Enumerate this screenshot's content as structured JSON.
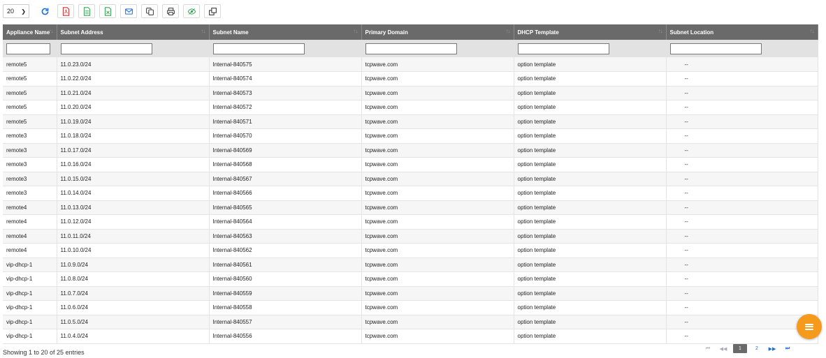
{
  "toolbar": {
    "page_size": "20",
    "buttons": [
      {
        "name": "refresh-icon",
        "color": "#1e6fd9"
      },
      {
        "name": "pdf-icon",
        "color": "#d9322b"
      },
      {
        "name": "csv-icon",
        "color": "#3aa655"
      },
      {
        "name": "excel-icon",
        "color": "#3aa655"
      },
      {
        "name": "email-icon",
        "color": "#1e6fd9"
      },
      {
        "name": "copy-icon",
        "color": "#333333"
      },
      {
        "name": "print-icon",
        "color": "#333333"
      },
      {
        "name": "visibility-icon",
        "color": "#3aa655"
      },
      {
        "name": "columns-icon",
        "color": "#333333"
      }
    ]
  },
  "table": {
    "columns": [
      "Appliance Name",
      "Subnet Address",
      "Subnet Name",
      "Primary Domain",
      "DHCP Template",
      "Subnet Location"
    ],
    "rows": [
      [
        "remote5",
        "11.0.23.0/24",
        "Internal-840575",
        "tcpwave.com",
        "option template",
        "--"
      ],
      [
        "remote5",
        "11.0.22.0/24",
        "Internal-840574",
        "tcpwave.com",
        "option template",
        "--"
      ],
      [
        "remote5",
        "11.0.21.0/24",
        "Internal-840573",
        "tcpwave.com",
        "option template",
        "--"
      ],
      [
        "remote5",
        "11.0.20.0/24",
        "Internal-840572",
        "tcpwave.com",
        "option template",
        "--"
      ],
      [
        "remote5",
        "11.0.19.0/24",
        "Internal-840571",
        "tcpwave.com",
        "option template",
        "--"
      ],
      [
        "remote3",
        "11.0.18.0/24",
        "Internal-840570",
        "tcpwave.com",
        "option template",
        "--"
      ],
      [
        "remote3",
        "11.0.17.0/24",
        "Internal-840569",
        "tcpwave.com",
        "option template",
        "--"
      ],
      [
        "remote3",
        "11.0.16.0/24",
        "Internal-840568",
        "tcpwave.com",
        "option template",
        "--"
      ],
      [
        "remote3",
        "11.0.15.0/24",
        "Internal-840567",
        "tcpwave.com",
        "option template",
        "--"
      ],
      [
        "remote3",
        "11.0.14.0/24",
        "Internal-840566",
        "tcpwave.com",
        "option template",
        "--"
      ],
      [
        "remote4",
        "11.0.13.0/24",
        "Internal-840565",
        "tcpwave.com",
        "option template",
        "--"
      ],
      [
        "remote4",
        "11.0.12.0/24",
        "Internal-840564",
        "tcpwave.com",
        "option template",
        "--"
      ],
      [
        "remote4",
        "11.0.11.0/24",
        "Internal-840563",
        "tcpwave.com",
        "option template",
        "--"
      ],
      [
        "remote4",
        "11.0.10.0/24",
        "Internal-840562",
        "tcpwave.com",
        "option template",
        "--"
      ],
      [
        "vip-dhcp-1",
        "11.0.9.0/24",
        "Internal-840561",
        "tcpwave.com",
        "option template",
        "--"
      ],
      [
        "vip-dhcp-1",
        "11.0.8.0/24",
        "Internal-840560",
        "tcpwave.com",
        "option template",
        "--"
      ],
      [
        "vip-dhcp-1",
        "11.0.7.0/24",
        "Internal-840559",
        "tcpwave.com",
        "option template",
        "--"
      ],
      [
        "vip-dhcp-1",
        "11.0.6.0/24",
        "Internal-840558",
        "tcpwave.com",
        "option template",
        "--"
      ],
      [
        "vip-dhcp-1",
        "11.0.5.0/24",
        "Internal-840557",
        "tcpwave.com",
        "option template",
        "--"
      ],
      [
        "vip-dhcp-1",
        "11.0.4.0/24",
        "Internal-840556",
        "tcpwave.com",
        "option template",
        "--"
      ]
    ]
  },
  "footer": {
    "info": "Showing 1 to 20 of 25 entries"
  },
  "pagination": {
    "first": "⏮",
    "prev": "◀◀",
    "pages": [
      "1",
      "2"
    ],
    "active_page": "1",
    "next": "▶▶",
    "last": "⏭"
  },
  "colors": {
    "header_bg": "#6a6a6a",
    "fab": "#f59a1a"
  }
}
